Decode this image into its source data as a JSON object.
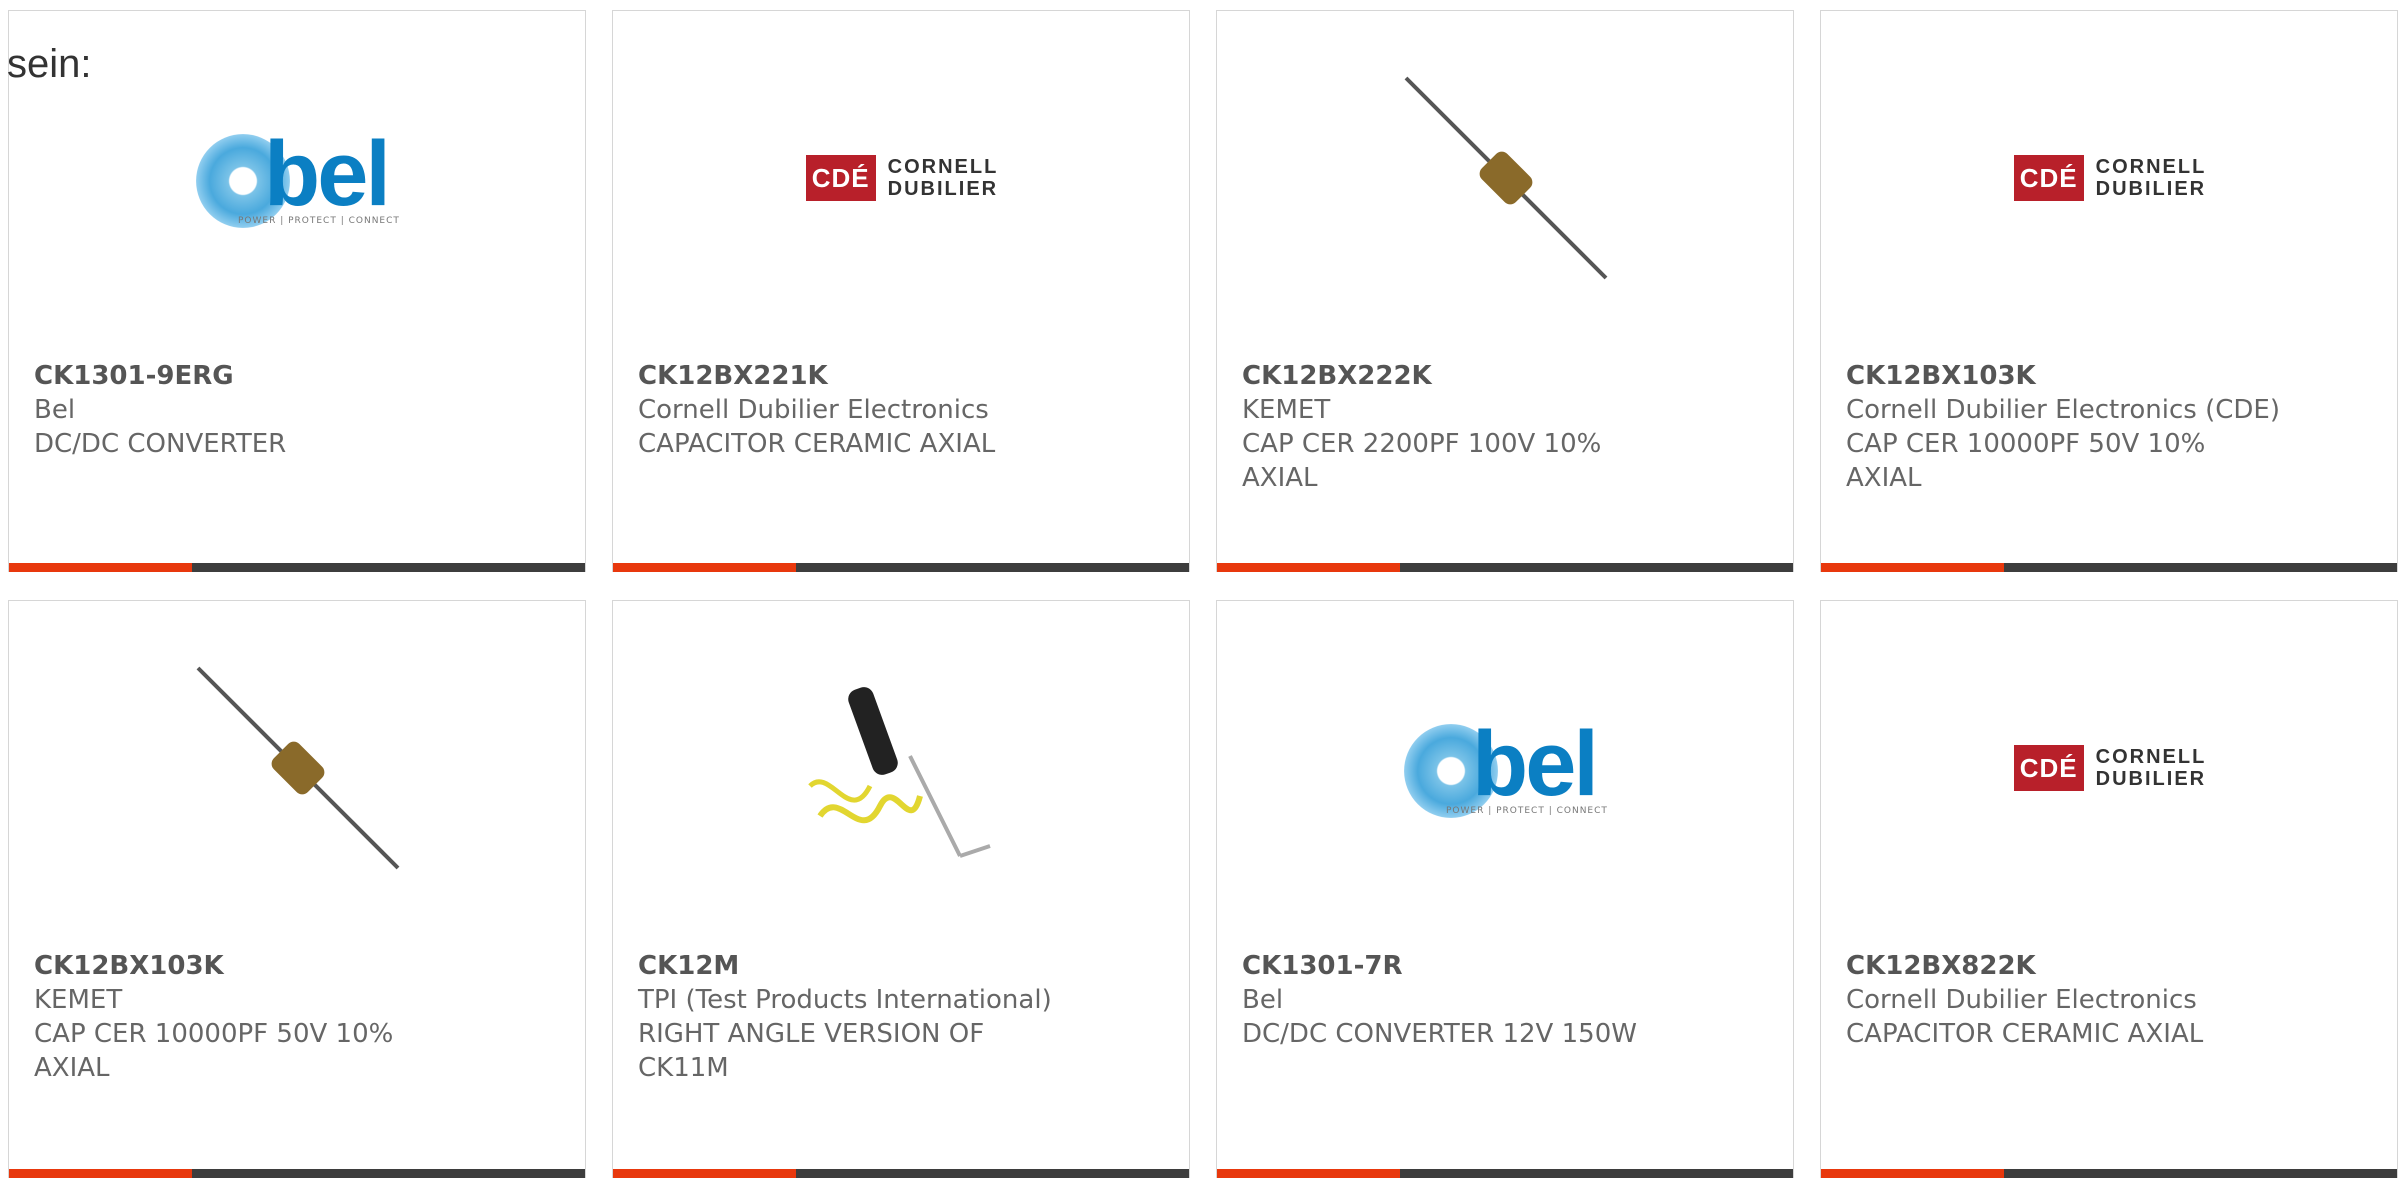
{
  "heading": "sein:",
  "products": [
    {
      "part": "CK1301-9ERG",
      "manufacturer": "Bel",
      "description": "DC/DC CONVERTER",
      "image": "bel-logo"
    },
    {
      "part": "CK12BX221K",
      "manufacturer": "Cornell Dubilier Electronics",
      "description": "CAPACITOR CERAMIC AXIAL",
      "image": "cde-logo"
    },
    {
      "part": "CK12BX222K",
      "manufacturer": "KEMET",
      "description": "CAP CER 2200PF 100V 10% AXIAL",
      "image": "axial-capacitor"
    },
    {
      "part": "CK12BX103K",
      "manufacturer": "Cornell Dubilier Electronics (CDE)",
      "description": "CAP CER 10000PF 50V 10% AXIAL",
      "image": "cde-logo"
    },
    {
      "part": "CK12BX103K",
      "manufacturer": "KEMET",
      "description": "CAP CER 10000PF 50V 10% AXIAL",
      "image": "axial-capacitor"
    },
    {
      "part": "CK12M",
      "manufacturer": "TPI (Test Products International)",
      "description": "RIGHT ANGLE VERSION OF CK11M",
      "image": "probe-cable"
    },
    {
      "part": "CK1301-7R",
      "manufacturer": "Bel",
      "description": "DC/DC CONVERTER 12V 150W",
      "image": "bel-logo"
    },
    {
      "part": "CK12BX822K",
      "manufacturer": "Cornell Dubilier Electronics",
      "description": "CAPACITOR CERAMIC AXIAL",
      "image": "cde-logo"
    }
  ],
  "logos": {
    "bel": {
      "word": "bel",
      "tagline": "POWER | PROTECT | CONNECT"
    },
    "cde": {
      "box": "CDÉ",
      "line1": "CORNELL",
      "line2": "DUBILIER"
    }
  },
  "colors": {
    "accent": "#e8380d",
    "bar": "#3d3d3d"
  }
}
